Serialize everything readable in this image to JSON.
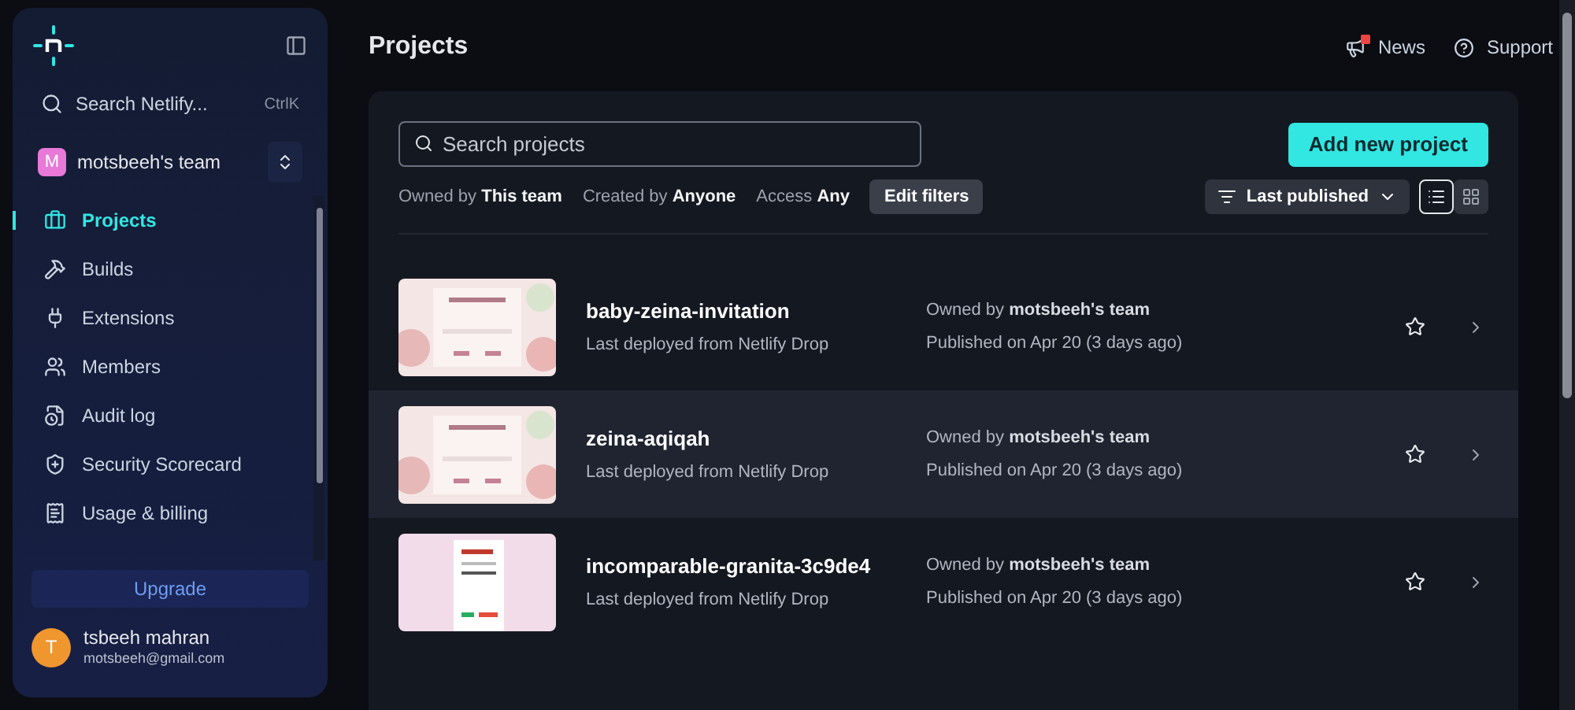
{
  "sidebar": {
    "search": {
      "placeholder": "Search Netlify...",
      "shortcut": "CtrlK"
    },
    "team": {
      "initial": "M",
      "name": "motsbeeh's team"
    },
    "items": [
      {
        "label": "Projects",
        "selected": true
      },
      {
        "label": "Builds",
        "selected": false
      },
      {
        "label": "Extensions",
        "selected": false
      },
      {
        "label": "Members",
        "selected": false
      },
      {
        "label": "Audit log",
        "selected": false
      },
      {
        "label": "Security Scorecard",
        "selected": false
      },
      {
        "label": "Usage & billing",
        "selected": false
      }
    ],
    "upgrade": "Upgrade",
    "user": {
      "initial": "T",
      "name": "tsbeeh mahran",
      "email": "motsbeeh@gmail.com"
    }
  },
  "header": {
    "title": "Projects",
    "links": [
      {
        "label": "News",
        "unread": true
      },
      {
        "label": "Support"
      }
    ]
  },
  "toolbar": {
    "search_placeholder": "Search projects",
    "add_button": "Add new project",
    "filters": [
      {
        "label": "Owned by",
        "value": "This team"
      },
      {
        "label": "Created by",
        "value": "Anyone"
      },
      {
        "label": "Access",
        "value": "Any"
      }
    ],
    "edit_filters": "Edit filters",
    "sort": "Last published",
    "views": [
      {
        "kind": "list",
        "selected": true
      },
      {
        "kind": "grid",
        "selected": false
      }
    ]
  },
  "projects": [
    {
      "name": "baby-zeina-invitation",
      "source": "Last deployed from Netlify Drop",
      "owner_label": "Owned by",
      "owner": "motsbeeh's team",
      "published": "Published on Apr 20 (3 days ago)",
      "starred": false,
      "hovered": false
    },
    {
      "name": "zeina-aqiqah",
      "source": "Last deployed from Netlify Drop",
      "owner_label": "Owned by",
      "owner": "motsbeeh's team",
      "published": "Published on Apr 20 (3 days ago)",
      "starred": false,
      "hovered": true
    },
    {
      "name": "incomparable-granita-3c9de4",
      "source": "Last deployed from Netlify Drop",
      "owner_label": "Owned by",
      "owner": "motsbeeh's team",
      "published": "Published on Apr 20 (3 days ago)",
      "starred": false,
      "hovered": false
    }
  ]
}
